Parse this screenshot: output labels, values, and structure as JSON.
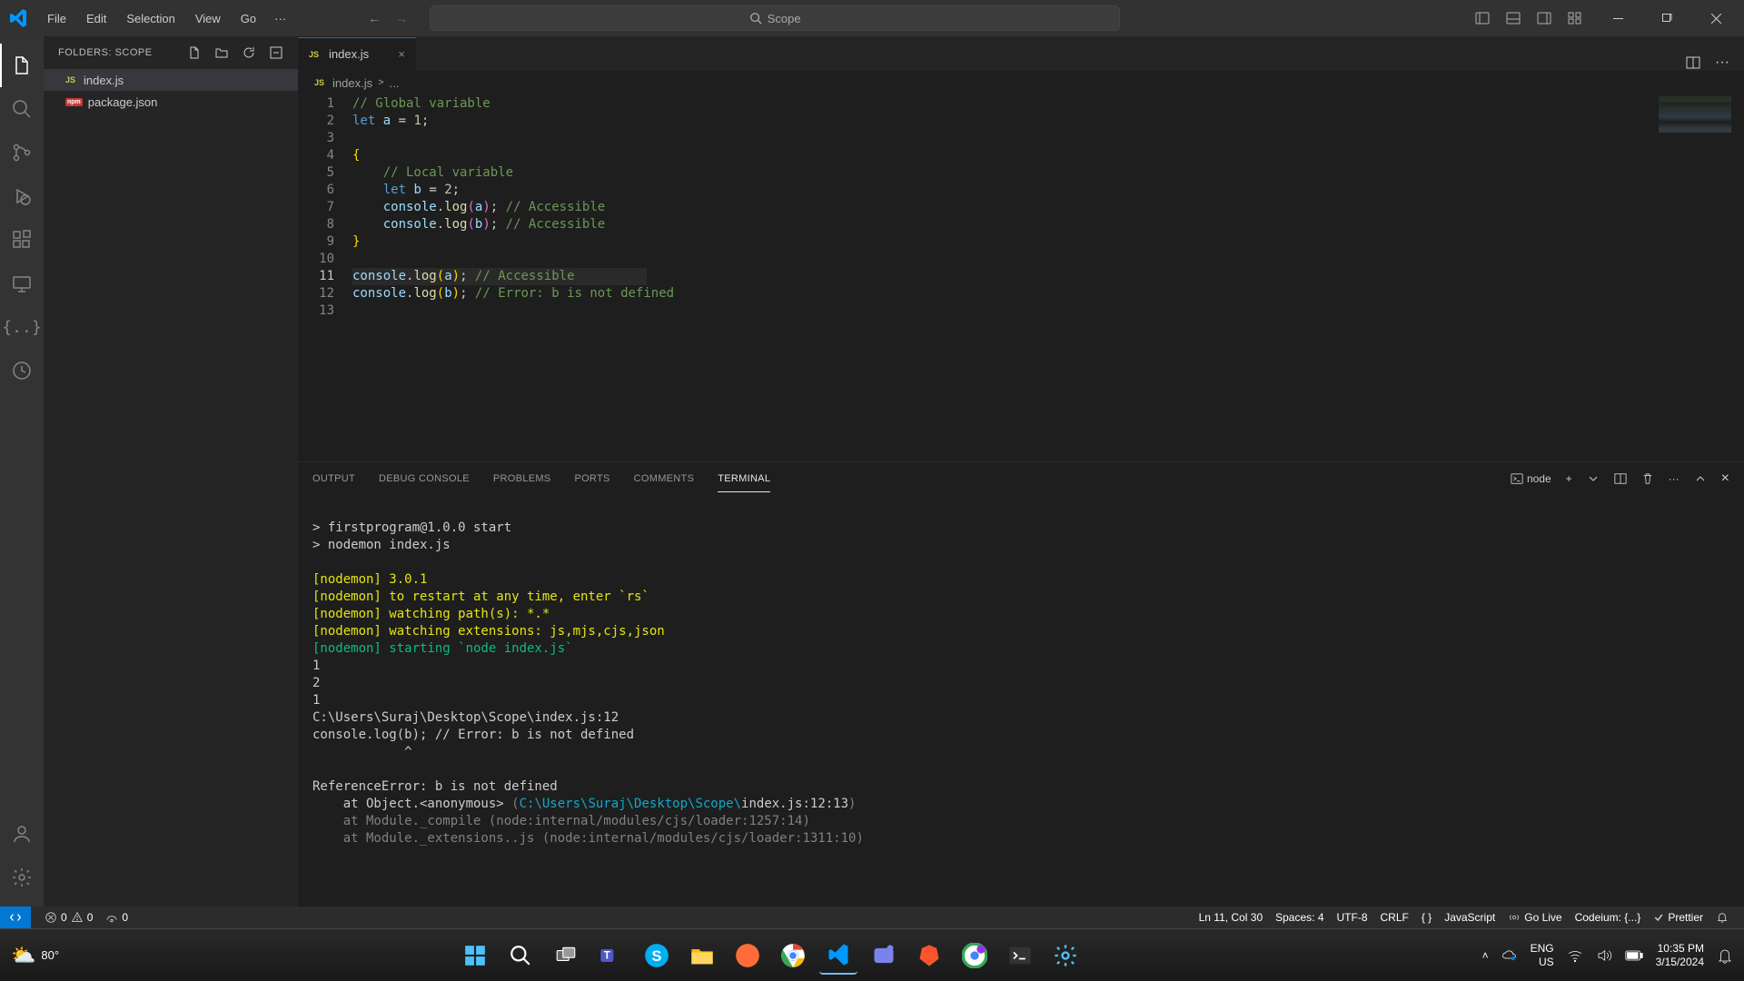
{
  "menu": [
    "File",
    "Edit",
    "Selection",
    "View",
    "Go"
  ],
  "search_label": "Scope",
  "sidebar": {
    "header": "FOLDERS: SCOPE",
    "files": [
      {
        "name": "index.js",
        "icon": "JS",
        "active": true
      },
      {
        "name": "package.json",
        "icon": "npm",
        "active": false
      }
    ]
  },
  "tab": {
    "icon": "JS",
    "name": "index.js"
  },
  "breadcrumb": {
    "icon": "JS",
    "file": "index.js",
    "sep": ">",
    "part": "..."
  },
  "code_lines": [
    {
      "n": 1,
      "html": "<span class='tok-comment'>// Global variable</span>"
    },
    {
      "n": 2,
      "html": "<span class='tok-keyword'>let</span> <span class='tok-var'>a</span> = <span class='tok-num'>1</span>;"
    },
    {
      "n": 3,
      "html": ""
    },
    {
      "n": 4,
      "html": "<span class='tok-brace2'>{</span>"
    },
    {
      "n": 5,
      "html": "    <span class='tok-comment'>// Local variable</span>"
    },
    {
      "n": 6,
      "html": "    <span class='tok-keyword'>let</span> <span class='tok-var'>b</span> = <span class='tok-num'>2</span>;"
    },
    {
      "n": 7,
      "html": "    <span class='tok-obj'>console</span>.<span class='tok-method'>log</span><span class='tok-brace'>(</span><span class='tok-var'>a</span><span class='tok-brace'>)</span>; <span class='tok-comment'>// Accessible</span>"
    },
    {
      "n": 8,
      "html": "    <span class='tok-obj'>console</span>.<span class='tok-method'>log</span><span class='tok-brace'>(</span><span class='tok-var'>b</span><span class='tok-brace'>)</span>; <span class='tok-comment'>// Accessible</span>"
    },
    {
      "n": 9,
      "html": "<span class='tok-brace2'>}</span>"
    },
    {
      "n": 10,
      "html": ""
    },
    {
      "n": 11,
      "html": "<span class='tok-obj'>console</span>.<span class='tok-method'>log</span><span class='tok-brace2'>(</span><span class='tok-var'>a</span><span class='tok-brace2'>)</span>; <span class='tok-comment'>// Accessible</span>",
      "current": true
    },
    {
      "n": 12,
      "html": "<span class='tok-obj'>console</span>.<span class='tok-method'>log</span><span class='tok-brace2'>(</span><span class='tok-var'>b</span><span class='tok-brace2'>)</span>; <span class='tok-comment'>// Error: b is not defined</span>"
    },
    {
      "n": 13,
      "html": ""
    }
  ],
  "panel_tabs": [
    "OUTPUT",
    "DEBUG CONSOLE",
    "PROBLEMS",
    "PORTS",
    "COMMENTS",
    "TERMINAL"
  ],
  "panel_active": "TERMINAL",
  "terminal_type": "node",
  "terminal_lines": [
    "",
    "> firstprogram@1.0.0 start",
    "> nodemon index.js",
    "",
    "<span class='t-yellow'>[nodemon] 3.0.1</span>",
    "<span class='t-yellow'>[nodemon] to restart at any time, enter `rs`</span>",
    "<span class='t-yellow'>[nodemon] watching path(s): *.*</span>",
    "<span class='t-yellow'>[nodemon] watching extensions: js,mjs,cjs,json</span>",
    "<span class='t-green'>[nodemon] starting `node index.js`</span>",
    "1",
    "2",
    "1",
    "C:\\Users\\Suraj\\Desktop\\Scope\\index.js:12",
    "console.log(b); // Error: b is not defined",
    "            ^",
    "",
    "ReferenceError: b is not defined",
    "    at Object.&lt;anonymous&gt; <span class='t-grey'>(</span><span class='t-cyan'>C:\\Users\\Suraj\\Desktop\\Scope\\</span>index.js:12:13<span class='t-grey'>)</span>",
    "<span class='t-grey'>    at Module._compile (node:internal/modules/cjs/loader:1257:14)</span>",
    "<span class='t-grey'>    at Module._extensions..js (node:internal/modules/cjs/loader:1311:10)</span>"
  ],
  "status": {
    "errors": "0",
    "warnings": "0",
    "ports": "0",
    "position": "Ln 11, Col 30",
    "spaces": "Spaces: 4",
    "encoding": "UTF-8",
    "eol": "CRLF",
    "bracket": "{ }",
    "language": "JavaScript",
    "golive": "Go Live",
    "codeium": "Codeium: {...}",
    "prettier": "Prettier"
  },
  "taskbar": {
    "weather": "80°",
    "lang1": "ENG",
    "lang2": "US",
    "time": "10:35 PM",
    "date": "3/15/2024"
  }
}
